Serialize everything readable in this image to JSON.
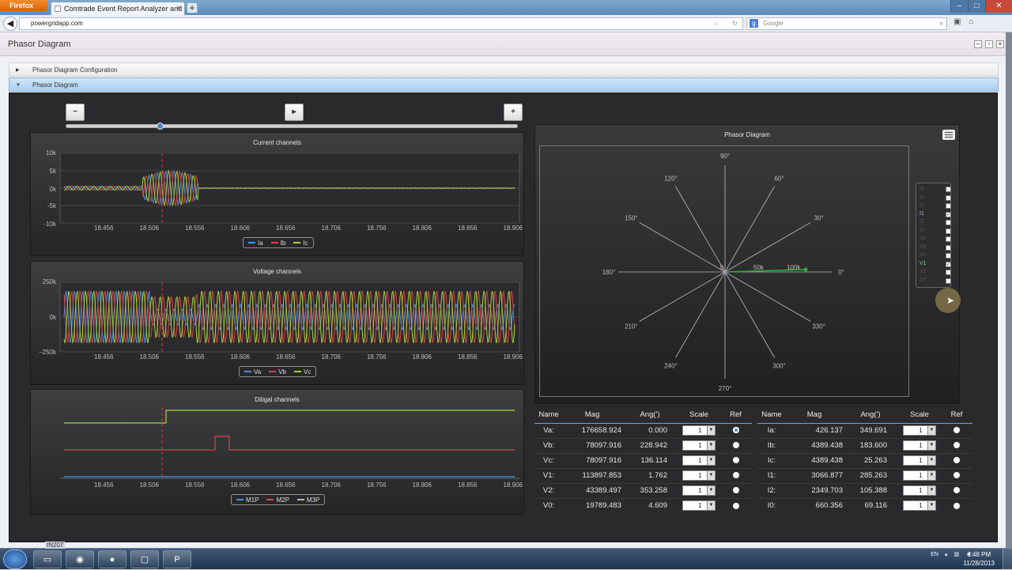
{
  "browser": {
    "menu_button": "Firefox",
    "tab_title": "Comtrade Event Report Analyzer and Vie...",
    "new_tab": "+",
    "url": "powergridapp.com",
    "search_placeholder": "Google"
  },
  "app": {
    "title": "Phasor Diagram",
    "accordion": [
      {
        "label": "Phasor Diagram Configuration",
        "expanded": false
      },
      {
        "label": "Phasor Diagram",
        "expanded": true
      }
    ]
  },
  "controls": {
    "minus": "−",
    "play": "▸",
    "plus": "+",
    "slider_position": 0.2
  },
  "charts": {
    "x_ticks": [
      "18.456",
      "18.506",
      "18.556",
      "18.606",
      "18.656",
      "18.706",
      "18.756",
      "18.806",
      "18.856",
      "18.906"
    ],
    "current": {
      "title": "Current channels",
      "y_ticks": [
        "10k",
        "5k",
        "0k",
        "-5k",
        "-10k"
      ],
      "legend": [
        "Ia",
        "Ib",
        "Ic"
      ]
    },
    "voltage": {
      "title": "Voltage channels",
      "y_ticks": [
        "250k",
        "0k",
        "−250k"
      ],
      "legend": [
        "Va",
        "Vb",
        "Vc"
      ]
    },
    "digital": {
      "title": "Ditigal channels",
      "legend": [
        "M1P",
        "M2P",
        "M3P"
      ]
    }
  },
  "series_colors": {
    "a": "#4b8fe0",
    "b": "#d64646",
    "c": "#a8d43a"
  },
  "chart_data": [
    {
      "type": "line",
      "title": "Current channels",
      "x": [
        18.456,
        18.506,
        18.556,
        18.606,
        18.656,
        18.706,
        18.756,
        18.806,
        18.856,
        18.906
      ],
      "ylim": [
        -10000,
        10000
      ],
      "series": [
        {
          "name": "Ia"
        },
        {
          "name": "Ib"
        },
        {
          "name": "Ic"
        }
      ],
      "cursor_x": 18.52
    },
    {
      "type": "line",
      "title": "Voltage channels",
      "x": [
        18.456,
        18.506,
        18.556,
        18.606,
        18.656,
        18.706,
        18.756,
        18.806,
        18.856,
        18.906
      ],
      "ylim": [
        -250000,
        250000
      ],
      "series": [
        {
          "name": "Va"
        },
        {
          "name": "Vb"
        },
        {
          "name": "Vc"
        }
      ],
      "cursor_x": 18.52
    },
    {
      "type": "line",
      "title": "Ditigal channels",
      "x": [
        18.456,
        18.506,
        18.556,
        18.606,
        18.656,
        18.706,
        18.756,
        18.806,
        18.856,
        18.906
      ],
      "series": [
        {
          "name": "M1P"
        },
        {
          "name": "M2P"
        },
        {
          "name": "M3P"
        }
      ],
      "cursor_x": 18.52
    }
  ],
  "phasor": {
    "title": "Phasor Diagram",
    "angles": [
      "90°",
      "60°",
      "30°",
      "0°",
      "330°",
      "300°",
      "270°",
      "240°",
      "210°",
      "180°",
      "150°",
      "120°"
    ],
    "radial_ticks": [
      "0",
      "50k",
      "100k"
    ],
    "legend": [
      {
        "label": "Ia",
        "checked": false
      },
      {
        "label": "Ib",
        "checked": false
      },
      {
        "label": "Ic",
        "checked": false
      },
      {
        "label": "I1",
        "checked": true
      },
      {
        "label": "I2",
        "checked": false
      },
      {
        "label": "I0",
        "checked": false
      },
      {
        "label": "Va",
        "checked": false
      },
      {
        "label": "Vb",
        "checked": false
      },
      {
        "label": "Vc",
        "checked": false
      },
      {
        "label": "V1",
        "checked": true
      },
      {
        "label": "V2",
        "checked": false
      },
      {
        "label": "V0",
        "checked": false
      }
    ]
  },
  "tables": {
    "headers": [
      "Name",
      "Mag",
      "Ang(')",
      "Scale",
      "Ref"
    ],
    "left": [
      {
        "name": "Va:",
        "mag": "176658.924",
        "ang": "0.000",
        "scale": "1",
        "ref": true
      },
      {
        "name": "Vb:",
        "mag": "78097.916",
        "ang": "228.942",
        "scale": "1",
        "ref": false
      },
      {
        "name": "Vc:",
        "mag": "78097.916",
        "ang": "136.114",
        "scale": "1",
        "ref": false
      },
      {
        "name": "V1:",
        "mag": "113897.853",
        "ang": "1.762",
        "scale": "1",
        "ref": false
      },
      {
        "name": "V2:",
        "mag": "43389.497",
        "ang": "353.258",
        "scale": "1",
        "ref": false
      },
      {
        "name": "V0:",
        "mag": "19789.483",
        "ang": "4.609",
        "scale": "1",
        "ref": false
      }
    ],
    "right": [
      {
        "name": "Ia:",
        "mag": "426.137",
        "ang": "349.691",
        "scale": "1",
        "ref": false
      },
      {
        "name": "Ib:",
        "mag": "4389.438",
        "ang": "183.600",
        "scale": "1",
        "ref": false
      },
      {
        "name": "Ic:",
        "mag": "4389.438",
        "ang": "25.263",
        "scale": "1",
        "ref": false
      },
      {
        "name": "I1:",
        "mag": "3066.877",
        "ang": "285.263",
        "scale": "1",
        "ref": false
      },
      {
        "name": "I2:",
        "mag": "2349.703",
        "ang": "105.388",
        "scale": "1",
        "ref": false
      },
      {
        "name": "I0:",
        "mag": "660.356",
        "ang": "69.116",
        "scale": "1",
        "ref": false
      }
    ]
  },
  "taskbar": {
    "tooltip": "IN207",
    "language": "EN",
    "time": "3:48 PM",
    "date": "11/28/2013"
  }
}
